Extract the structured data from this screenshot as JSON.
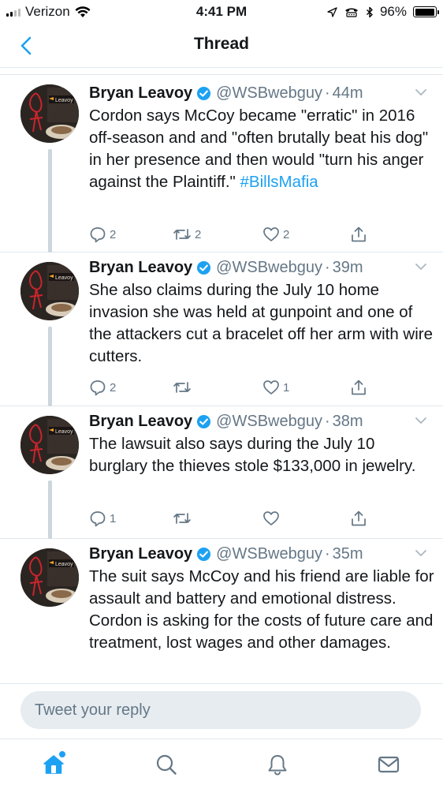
{
  "status_bar": {
    "carrier": "Verizon",
    "time": "4:41 PM",
    "battery": "96%",
    "battery_level": 0.96
  },
  "nav": {
    "title": "Thread"
  },
  "tweets": [
    {
      "name": "Bryan Leavoy",
      "handle": "@WSBwebguy",
      "separator": "·",
      "time": "44m",
      "text_before": "Cordon says McCoy became \"erratic\" in 2016 off-season and and \"often brutally beat his dog\" in her presence and then would \"turn his anger against the Plaintiff.\" ",
      "hashtag": "#BillsMafia",
      "reply_count": "2",
      "retweet_count": "2",
      "like_count": "2"
    },
    {
      "name": "Bryan Leavoy",
      "handle": "@WSBwebguy",
      "separator": "·",
      "time": "39m",
      "text_before": "She also claims during the July 10 home invasion she was held at gunpoint and one of the attackers cut a bracelet off her arm with wire cutters.",
      "hashtag": "",
      "reply_count": "2",
      "retweet_count": "",
      "like_count": "1"
    },
    {
      "name": "Bryan Leavoy",
      "handle": "@WSBwebguy",
      "separator": "·",
      "time": "38m",
      "text_before": "The lawsuit also says during the July 10 burglary the thieves stole $133,000 in jewelry.",
      "hashtag": "",
      "reply_count": "1",
      "retweet_count": "",
      "like_count": ""
    },
    {
      "name": "Bryan Leavoy",
      "handle": "@WSBwebguy",
      "separator": "·",
      "time": "35m",
      "text_before": "The suit says McCoy and his friend are liable for assault and battery and emotional distress.  Cordon is asking for the costs of future care and treatment, lost wages and other damages.",
      "hashtag": "",
      "reply_count": "",
      "retweet_count": "",
      "like_count": ""
    }
  ],
  "avatar_label": "Leavoy",
  "reply": {
    "placeholder": "Tweet your reply"
  },
  "tab_bar": {
    "items": [
      "home-icon",
      "search-icon",
      "notifications-icon",
      "messages-icon"
    ]
  },
  "colors": {
    "accent": "#1da1f2",
    "secondary_text": "#657786",
    "thread_line": "#ccd6dd",
    "input_bg": "#e6ecf0"
  }
}
